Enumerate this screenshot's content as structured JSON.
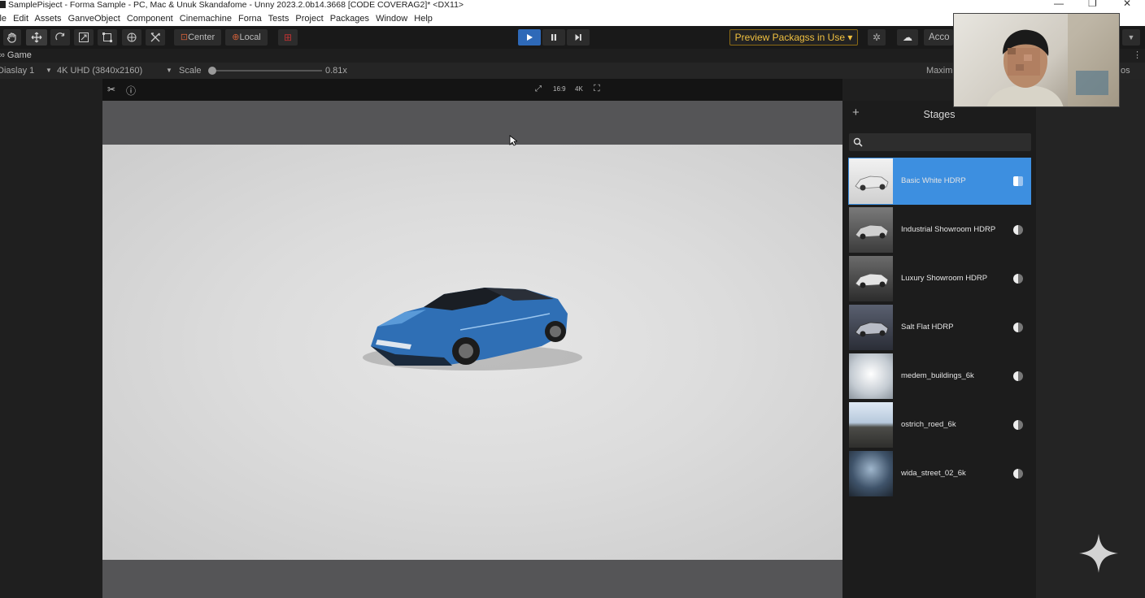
{
  "window": {
    "title": "SamplePisject - Forma Sample - PC, Mac & Unuk Skandafome - Unny 2023.2.0b14.3668 [CODE COVERAG2]* <DX11>",
    "controls": [
      "—",
      "❐",
      "✕"
    ]
  },
  "menu": [
    "ile",
    "Edit",
    "Assets",
    "GanveObject",
    "Component",
    "Cinemachine",
    "Forna",
    "Tests",
    "Project",
    "Packages",
    "Window",
    "Help"
  ],
  "toolbar": {
    "tools": [
      "hand-tool",
      "move-tool",
      "rotate-tool",
      "scale-tool",
      "rect-tool",
      "transform-tool",
      "custom-tool"
    ],
    "pivot_label": "Center",
    "space_label": "Local",
    "preview_packages": "Preview Packagss in Use ▾",
    "account_label": "Acco"
  },
  "game_view": {
    "tab_label": "Game",
    "display": "Diaslay 1",
    "resolution": "4K UHD (3840x2160)",
    "scale_label": "Scale",
    "scale_value": "0.81x",
    "maximize_label": "Maxim",
    "stats_label": "os",
    "scale_fraction": 0.0
  },
  "stages_panel": {
    "title": "Stages",
    "add_label": "+",
    "search_placeholder": "",
    "items": [
      {
        "label": "Basic White HDRP",
        "selected": true
      },
      {
        "label": "Industrial Showroom HDRP",
        "selected": false
      },
      {
        "label": "Luxury Showroom HDRP",
        "selected": false
      },
      {
        "label": "Salt Flat HDRP",
        "selected": false
      },
      {
        "label": "medem_buildings_6k",
        "selected": false
      },
      {
        "label": "ostrich_roed_6k",
        "selected": false
      },
      {
        "label": "wida_street_02_6k",
        "selected": false
      }
    ]
  },
  "colors": {
    "selection": "#3d8fe0",
    "play_active": "#2e69b8",
    "preview_warning": "#f0c040",
    "car_body": "#3a7cc2"
  }
}
